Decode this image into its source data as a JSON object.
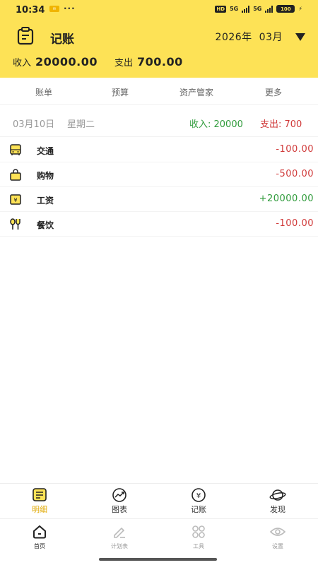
{
  "status": {
    "time": "10:34",
    "hd": "HD",
    "net1": "5G",
    "net2": "5G",
    "battery": "100"
  },
  "header": {
    "title": "记账",
    "year": "2026年",
    "month": "03月"
  },
  "summary": {
    "income_label": "收入",
    "income_value": "20000.00",
    "expense_label": "支出",
    "expense_value": "700.00"
  },
  "tabs": [
    "账单",
    "预算",
    "资产管家",
    "更多"
  ],
  "day": {
    "date": "03月10日",
    "weekday": "星期二",
    "income": "收入: 20000",
    "expense": "支出: 700"
  },
  "records": [
    {
      "name": "交通",
      "amount": "-100.00",
      "icon": "bus-icon"
    },
    {
      "name": "购物",
      "amount": "-500.00",
      "icon": "shopping-bag-icon"
    },
    {
      "name": "工资",
      "amount": "+20000.00",
      "icon": "wage-icon"
    },
    {
      "name": "餐饮",
      "amount": "-100.00",
      "icon": "utensils-icon"
    }
  ],
  "tool_nav": [
    "明细",
    "图表",
    "记账",
    "发现"
  ],
  "sys_nav": [
    "首页",
    "计划表",
    "工具",
    "设置"
  ],
  "colors": {
    "accent": "#fde256",
    "income": "#2f9b3b",
    "expense": "#d03a3a",
    "active_tab": "#e0a800"
  }
}
